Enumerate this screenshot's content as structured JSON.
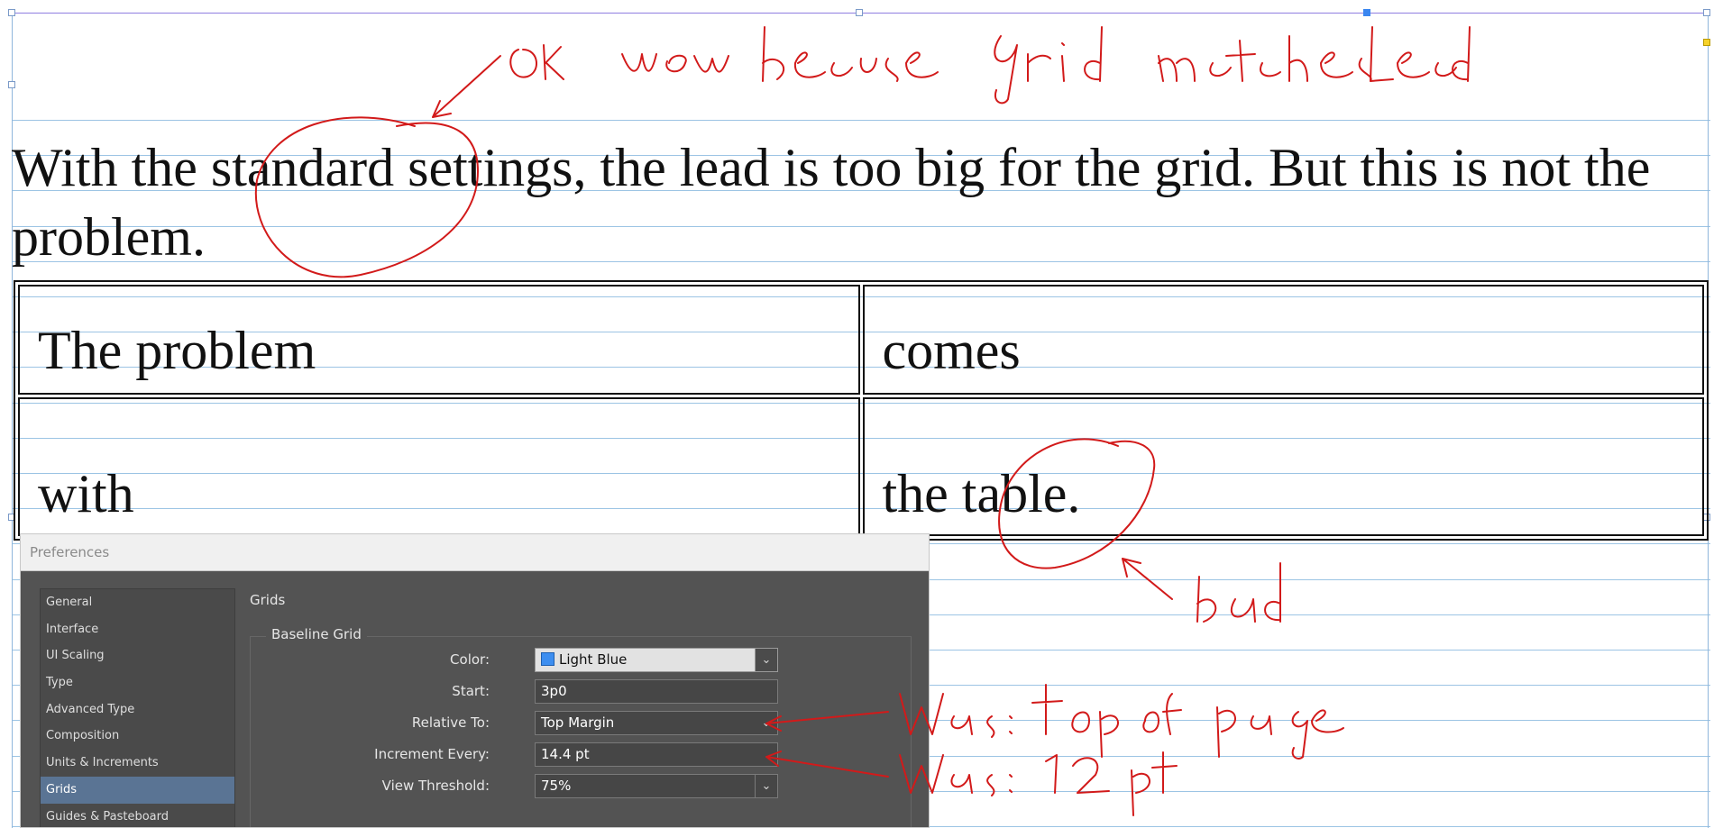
{
  "document": {
    "paragraph": "With the standard settings, the lead is too big for the grid. But this is not the problem.",
    "table": [
      [
        "The problem",
        "comes"
      ],
      [
        "with",
        "the table."
      ]
    ]
  },
  "annotations": [
    "OK now because grid matches lead",
    "bad",
    "Was: top of page",
    "Was: 12 pt"
  ],
  "dialog": {
    "title": "Preferences",
    "sidebar_items": [
      {
        "label": "General"
      },
      {
        "label": "Interface"
      },
      {
        "label": "UI Scaling"
      },
      {
        "label": "Type"
      },
      {
        "label": "Advanced Type"
      },
      {
        "label": "Composition"
      },
      {
        "label": "Units & Increments"
      },
      {
        "label": "Grids",
        "active": true
      },
      {
        "label": "Guides & Pasteboard"
      }
    ],
    "pane_title": "Grids",
    "section_title": "Baseline Grid",
    "fields": {
      "color": {
        "label": "Color:",
        "value": "Light Blue",
        "swatch": "#3d8ef0"
      },
      "start": {
        "label": "Start:",
        "value": "3p0"
      },
      "relative_to": {
        "label": "Relative To:",
        "value": "Top Margin"
      },
      "increment": {
        "label": "Increment Every:",
        "value": "14.4 pt"
      },
      "view_threshold": {
        "label": "View Threshold:",
        "value": "75%"
      }
    }
  },
  "colors": {
    "baseline_grid": "#9cc4e4",
    "annotation_ink": "#d21a1a",
    "dialog_bg": "#535353",
    "selected_item": "#5a7494"
  }
}
